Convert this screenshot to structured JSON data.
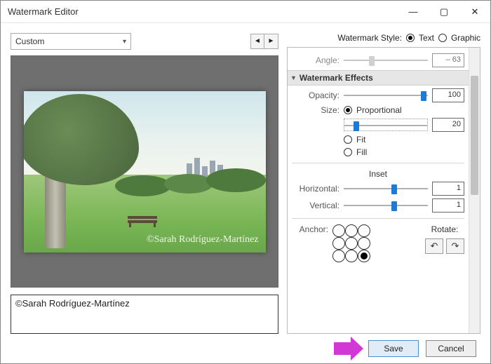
{
  "window": {
    "title": "Watermark Editor"
  },
  "preset": {
    "selected": "Custom"
  },
  "preview": {
    "watermark_text": "©Sarah Rodríguez-Martínez"
  },
  "text_field": {
    "value": "©Sarah Rodríguez-Martínez"
  },
  "style": {
    "label": "Watermark Style:",
    "text": "Text",
    "graphic": "Graphic",
    "selected": "text"
  },
  "angle": {
    "label": "Angle:",
    "value": "– 63"
  },
  "effects_header": "Watermark Effects",
  "opacity": {
    "label": "Opacity:",
    "value": "100",
    "pct": 95
  },
  "size": {
    "label": "Size:",
    "mode": "proportional",
    "proportional": "Proportional",
    "fit": "Fit",
    "fill": "Fill",
    "value": "20",
    "pct": 14
  },
  "inset": {
    "header": "Inset",
    "horizontal_label": "Horizontal:",
    "horizontal_value": "1",
    "horizontal_pct": 60,
    "vertical_label": "Vertical:",
    "vertical_value": "1",
    "vertical_pct": 60
  },
  "anchor": {
    "label": "Anchor:",
    "selected": 8
  },
  "rotate": {
    "label": "Rotate:"
  },
  "footer": {
    "save": "Save",
    "cancel": "Cancel"
  }
}
